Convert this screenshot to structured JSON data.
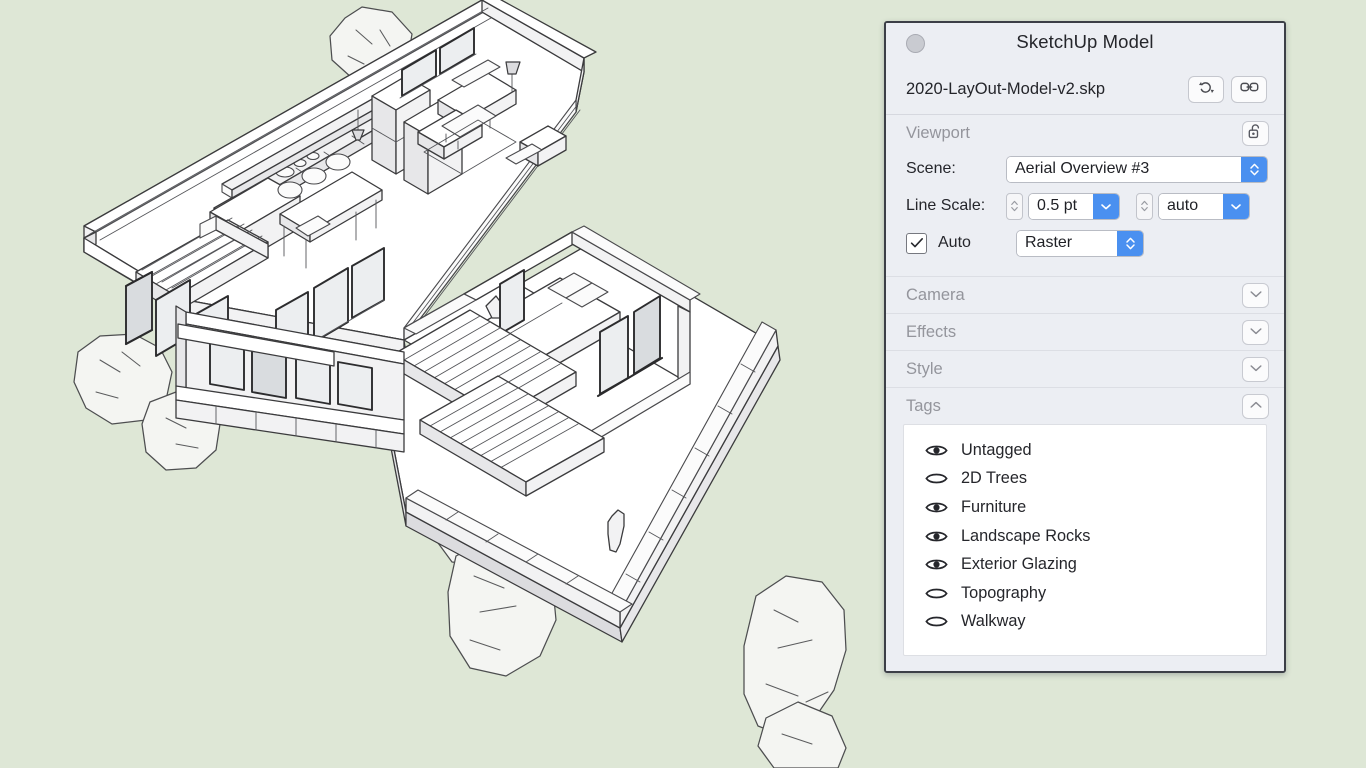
{
  "window": {
    "title": "SketchUp Model",
    "close_button": "close-dot",
    "file_name": "2020-LayOut-Model-v2.skp",
    "refresh_button_icon": "refresh-icon",
    "link_button_icon": "link-icon"
  },
  "viewport": {
    "title": "Viewport",
    "lock_button_icon": "unlock-icon",
    "scene_label": "Scene:",
    "scene_value": "Aerial Overview #3",
    "line_scale_label": "Line Scale:",
    "line_scale_value": "0.5 pt",
    "line_scale_profile_value": "auto",
    "auto_label": "Auto",
    "auto_checked": "✓",
    "render_mode_value": "Raster"
  },
  "sections": [
    {
      "title": "Camera",
      "expanded": false,
      "chevron": "chevron-down-icon"
    },
    {
      "title": "Effects",
      "expanded": false,
      "chevron": "chevron-down-icon"
    },
    {
      "title": "Style",
      "expanded": false,
      "chevron": "chevron-down-icon"
    },
    {
      "title": "Tags",
      "expanded": true,
      "chevron": "chevron-up-icon"
    }
  ],
  "tags": [
    {
      "name": "Untagged",
      "visible": true
    },
    {
      "name": "2D Trees",
      "visible": false
    },
    {
      "name": "Furniture",
      "visible": true
    },
    {
      "name": "Landscape Rocks",
      "visible": true
    },
    {
      "name": "Exterior Glazing",
      "visible": true
    },
    {
      "name": "Topography",
      "visible": false
    },
    {
      "name": "Walkway",
      "visible": false
    }
  ],
  "colors": {
    "canvas_background": "#dee7d6",
    "panel_background": "#eceef3",
    "panel_border": "#3c3f47",
    "accent_blue": "#4a90f0",
    "section_title": "#94959c",
    "model_line": "#3a3a3c",
    "model_fill": "#ffffff"
  },
  "model": {
    "description": "Axonometric SketchUp model of a two-wing house with kitchen, living room, bedroom, terrace, stairs and landscape rocks"
  }
}
